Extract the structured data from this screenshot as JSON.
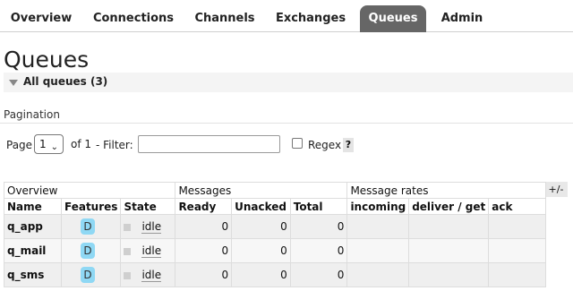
{
  "nav": {
    "tabs": [
      "Overview",
      "Connections",
      "Channels",
      "Exchanges",
      "Queues",
      "Admin"
    ],
    "active": "Queues"
  },
  "page": {
    "title": "Queues",
    "section": "All queues (3)"
  },
  "pagination": {
    "heading": "Pagination",
    "page_label": "Page",
    "page_value": "1",
    "of_label": "of 1",
    "filter_label": "- Filter:",
    "filter_value": "",
    "regex_label": "Regex",
    "help": "?"
  },
  "table": {
    "toggle": "+/-",
    "groups": [
      "Overview",
      "Messages",
      "Message rates"
    ],
    "columns": [
      "Name",
      "Features",
      "State",
      "Ready",
      "Unacked",
      "Total",
      "incoming",
      "deliver / get",
      "ack"
    ],
    "rows": [
      {
        "name": "q_app",
        "feature": "D",
        "state": "idle",
        "ready": "0",
        "unacked": "0",
        "total": "0",
        "incoming": "",
        "deliver_get": "",
        "ack": ""
      },
      {
        "name": "q_mail",
        "feature": "D",
        "state": "idle",
        "ready": "0",
        "unacked": "0",
        "total": "0",
        "incoming": "",
        "deliver_get": "",
        "ack": ""
      },
      {
        "name": "q_sms",
        "feature": "D",
        "state": "idle",
        "ready": "0",
        "unacked": "0",
        "total": "0",
        "incoming": "",
        "deliver_get": "",
        "ack": ""
      }
    ]
  },
  "colors": {
    "active_tab": "#666666",
    "feature_badge": "#8fd8f4"
  }
}
